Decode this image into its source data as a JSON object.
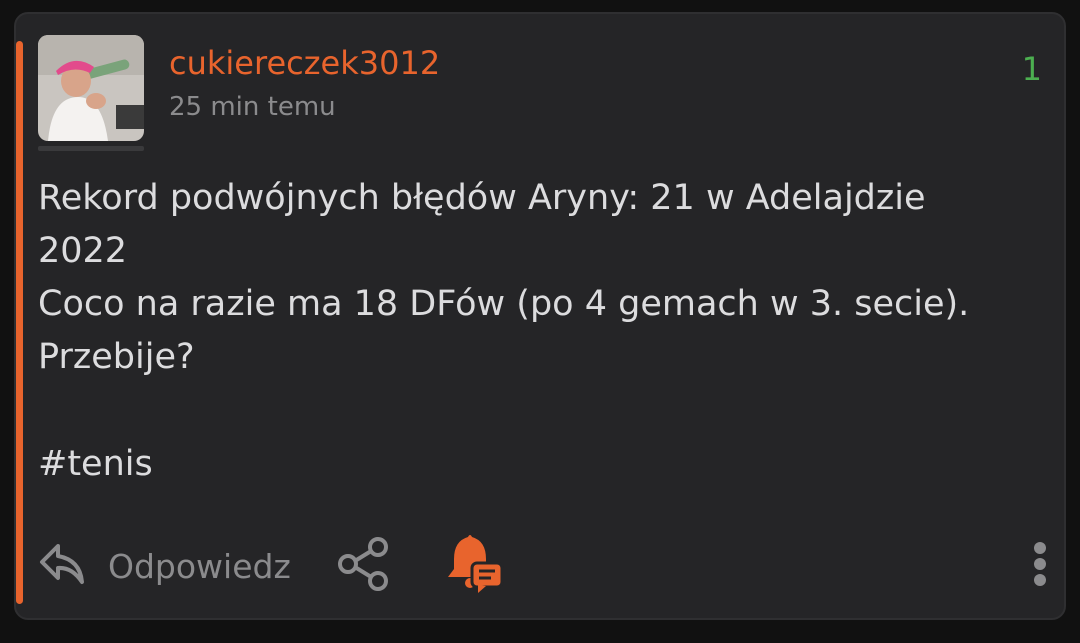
{
  "post": {
    "username": "cukiereczek3012",
    "time": "25 min temu",
    "votes": "1",
    "body": "Rekord podwójnych błędów Aryny: 21 w Adelajdzie\n2022\nCoco na razie ma 18 DFów (po 4 gemach w 3. secie).\nPrzebije?",
    "hashtag": "#tenis"
  },
  "actions": {
    "reply_label": "Odpowiedz",
    "reply_icon": "reply-arrow-icon",
    "share_icon": "share-icon",
    "notify_icon": "bell-comment-icon",
    "more_icon": "more-vertical-icon"
  },
  "colors": {
    "accent": "#e8642d",
    "votes": "#4caf50",
    "background": "#252527",
    "text": "#dcdcde",
    "muted": "#8b8b8d"
  }
}
